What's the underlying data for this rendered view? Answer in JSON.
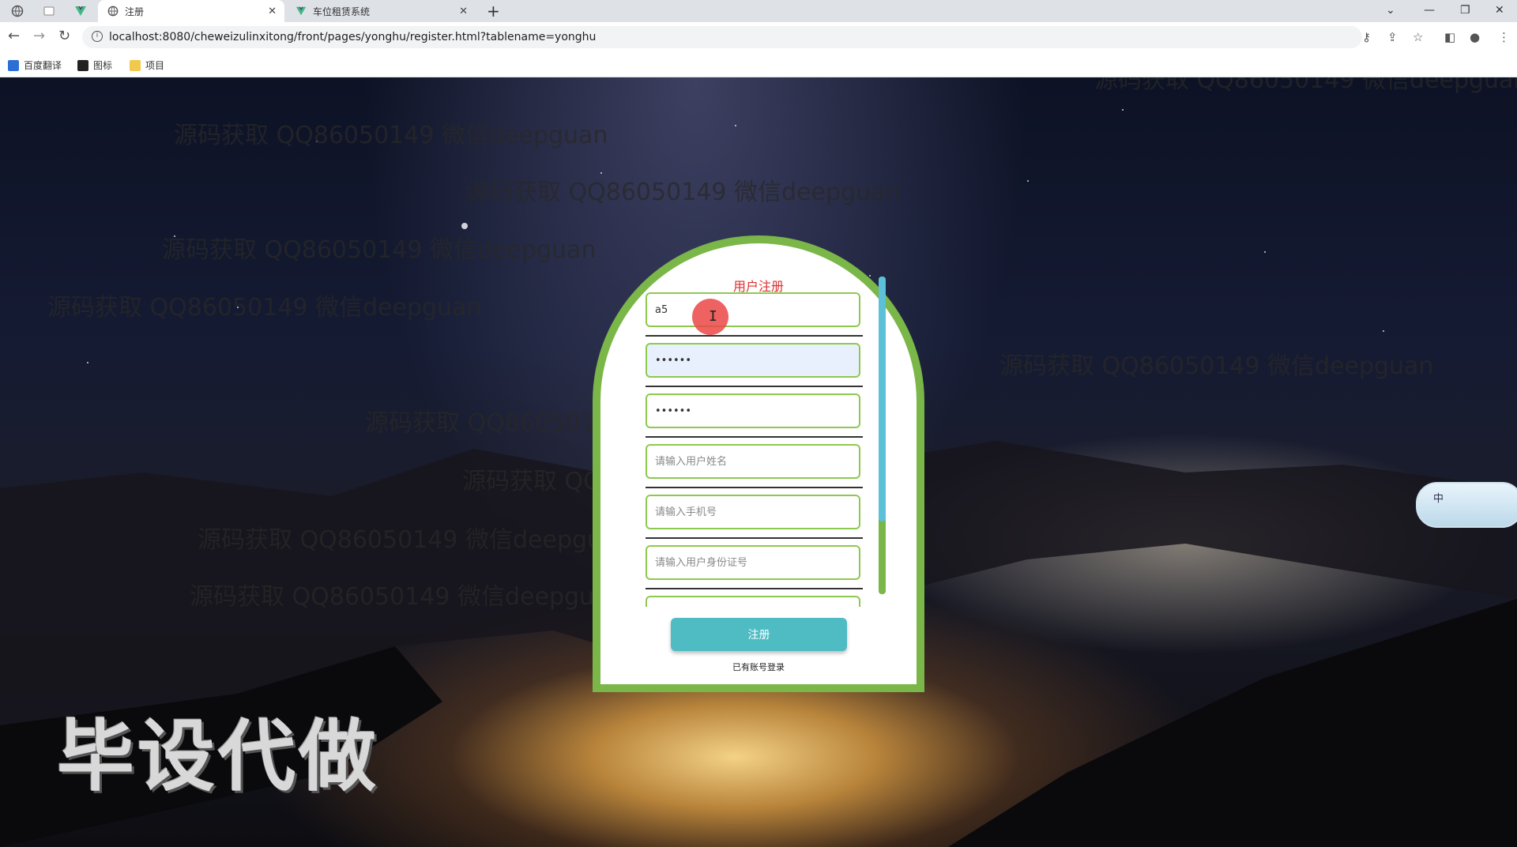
{
  "browser": {
    "tabs": [
      {
        "title": "注册",
        "active": true
      },
      {
        "title": "车位租赁系统",
        "active": false
      }
    ],
    "url": "localhost:8080/cheweizulinxitong/front/pages/yonghu/register.html?tablename=yonghu",
    "bookmarks": [
      "百度翻译",
      "图标",
      "项目"
    ]
  },
  "watermarks": [
    "源码获取 QQ86050149 微信deepguan"
  ],
  "big_watermark": "毕设代做",
  "form": {
    "title": "用户注册",
    "fields": [
      {
        "value": "a5",
        "placeholder": ""
      },
      {
        "value": "••••••",
        "placeholder": ""
      },
      {
        "value": "••••••",
        "placeholder": ""
      },
      {
        "value": "",
        "placeholder": "请输入用户姓名"
      },
      {
        "value": "",
        "placeholder": "请输入手机号"
      },
      {
        "value": "",
        "placeholder": "请输入用户身份证号"
      }
    ],
    "submit_label": "注册",
    "login_link": "已有账号登录"
  },
  "ime": {
    "label": "中"
  },
  "icons": [
    "back-icon",
    "forward-icon",
    "reload-icon",
    "info-icon",
    "key-icon",
    "share-icon",
    "star-icon",
    "sidebar-icon",
    "profile-icon",
    "menu-icon",
    "new-tab-icon",
    "close-icon",
    "minimize-icon",
    "maximize-icon",
    "tab-search-icon"
  ]
}
